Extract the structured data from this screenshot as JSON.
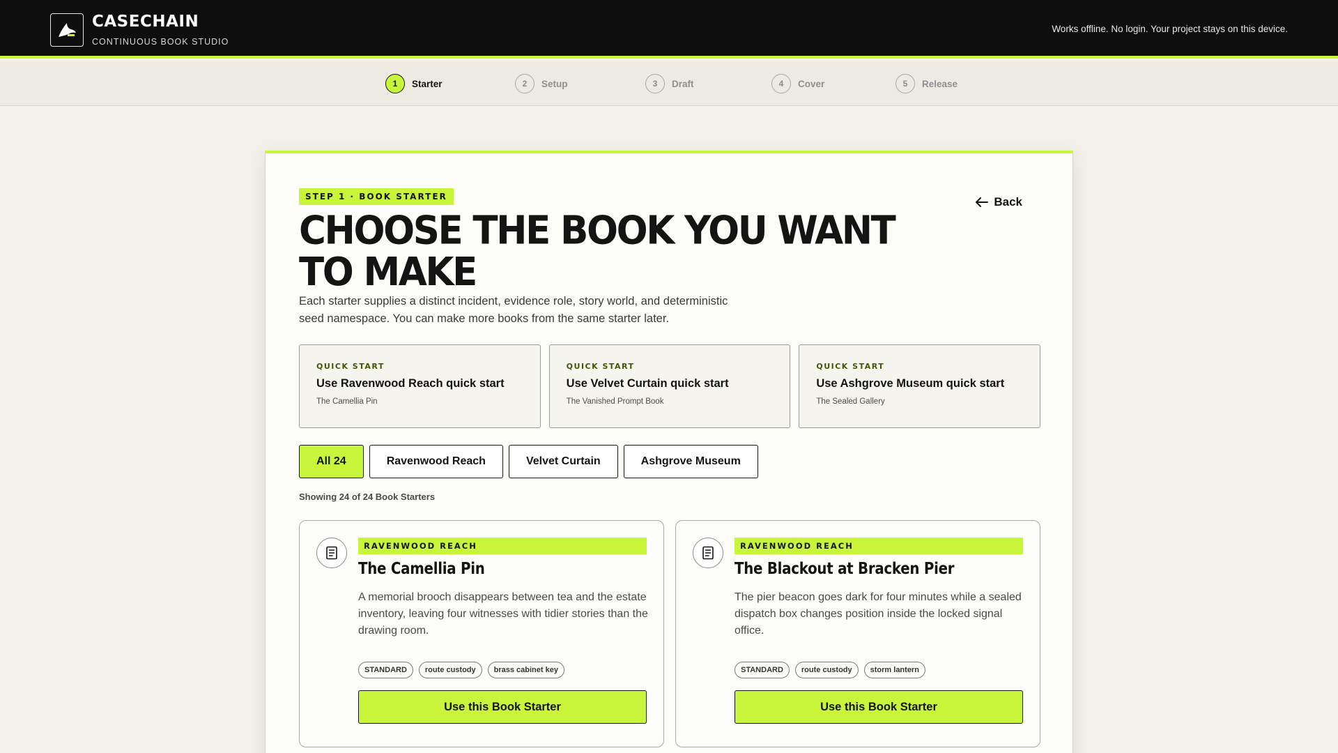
{
  "header": {
    "brand_name": "CASECHAIN",
    "brand_sub": "CONTINUOUS BOOK STUDIO",
    "offline_note": "Works offline. No login. Your project stays on this device."
  },
  "stepper": {
    "active_index": 1,
    "steps": [
      {
        "num": "1",
        "label": "Starter"
      },
      {
        "num": "2",
        "label": "Setup"
      },
      {
        "num": "3",
        "label": "Draft"
      },
      {
        "num": "4",
        "label": "Cover"
      },
      {
        "num": "5",
        "label": "Release"
      }
    ]
  },
  "main": {
    "eyebrow": "STEP 1 · BOOK STARTER",
    "back_label": "Back",
    "title": "CHOOSE THE BOOK YOU WANT TO MAKE",
    "description": "Each starter supplies a distinct incident, evidence role, story world, and deterministic seed namespace. You can make more books from the same starter later.",
    "quick_starts": [
      {
        "label": "QUICK START",
        "title": "Use Ravenwood Reach quick start",
        "sub": "The Camellia Pin"
      },
      {
        "label": "QUICK START",
        "title": "Use Velvet Curtain quick start",
        "sub": "The Vanished Prompt Book"
      },
      {
        "label": "QUICK START",
        "title": "Use Ashgrove Museum quick start",
        "sub": "The Sealed Gallery"
      }
    ],
    "filters": [
      {
        "label": "All 24",
        "active": true
      },
      {
        "label": "Ravenwood Reach",
        "active": false
      },
      {
        "label": "Velvet Curtain",
        "active": false
      },
      {
        "label": "Ashgrove Museum",
        "active": false
      }
    ],
    "showing": "Showing 24 of 24 Book Starters",
    "starters": [
      {
        "tag": "RAVENWOOD REACH",
        "title": "The Camellia Pin",
        "description": "A memorial brooch disappears between tea and the estate inventory, leaving four witnesses with tidier stories than the drawing room.",
        "chips": [
          "STANDARD",
          "route custody",
          "brass cabinet key"
        ],
        "button": "Use this Book Starter"
      },
      {
        "tag": "RAVENWOOD REACH",
        "title": "The Blackout at Bracken Pier",
        "description": "The pier beacon goes dark for four minutes while a sealed dispatch box changes position inside the locked signal office.",
        "chips": [
          "STANDARD",
          "route custody",
          "storm lantern"
        ],
        "button": "Use this Book Starter"
      }
    ]
  },
  "colors": {
    "accent": "#c8f53a",
    "header_bg": "#0e0e0e",
    "page_bg": "#f2f0e9"
  }
}
